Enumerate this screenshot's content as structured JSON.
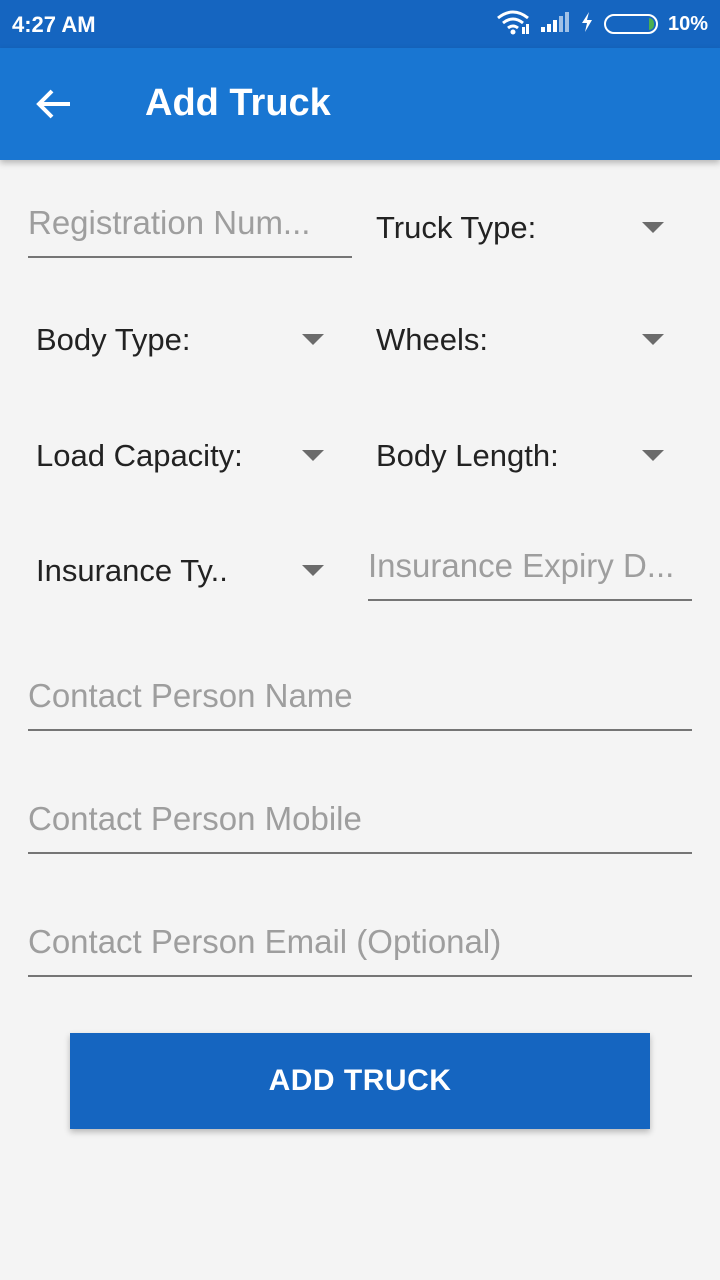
{
  "status_bar": {
    "time": "4:27 AM",
    "battery_percent": "10%",
    "battery_level": 0.1,
    "icons": [
      "wifi-icon",
      "signal-icon",
      "charging-icon",
      "battery-icon"
    ]
  },
  "app_bar": {
    "title": "Add Truck",
    "back_icon": "arrow-left-icon"
  },
  "form": {
    "registration_number": {
      "placeholder": "Registration Num...",
      "value": ""
    },
    "truck_type": {
      "label": "Truck Type:"
    },
    "body_type": {
      "label": "Body Type:"
    },
    "wheels": {
      "label": "Wheels:"
    },
    "load_capacity": {
      "label": "Load Capacity:"
    },
    "body_length": {
      "label": "Body Length:"
    },
    "insurance_type": {
      "label": "Insurance Ty.."
    },
    "insurance_expiry": {
      "placeholder": "Insurance Expiry D...",
      "value": ""
    },
    "contact_name": {
      "placeholder": "Contact Person Name",
      "value": ""
    },
    "contact_mobile": {
      "placeholder": "Contact Person Mobile",
      "value": ""
    },
    "contact_email": {
      "placeholder": "Contact Person Email (Optional)",
      "value": ""
    }
  },
  "submit_label": "ADD TRUCK",
  "colors": {
    "status_bar": "#1565c0",
    "app_bar": "#1976d2",
    "button": "#1565c0",
    "background": "#f4f4f4",
    "battery_fill": "#4caf50"
  }
}
